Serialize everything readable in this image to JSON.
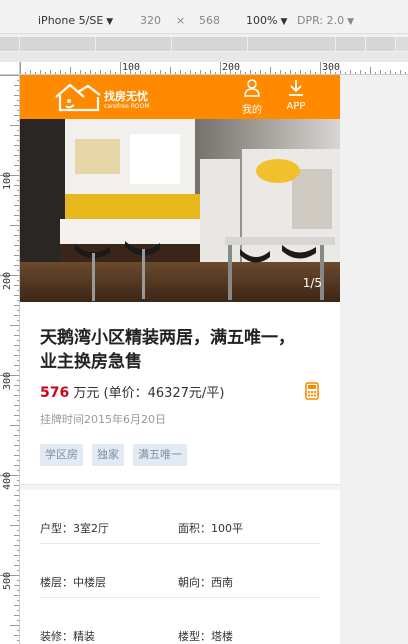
{
  "devtools": {
    "device": "iPhone 5/SE",
    "width": "320",
    "times": "×",
    "height": "568",
    "zoom": "100%",
    "dpr": "DPR: 2.0"
  },
  "ruler": {
    "h_labels": [
      "100",
      "200",
      "300"
    ],
    "v_labels": [
      "100",
      "200",
      "300",
      "400",
      "500"
    ]
  },
  "header": {
    "brand": "找房无忧",
    "brand_sub": "carefree ROOM",
    "me_label": "我的",
    "app_label": "APP",
    "bg_color": "#ff8a00"
  },
  "gallery": {
    "counter": "1/5"
  },
  "listing": {
    "title": "天鹅湾小区精装两居，满五唯一，业主换房急售",
    "price_amount": "576",
    "price_unit": "万元 (单价：46327元/平)",
    "listed_date": "挂牌时间2015年6月20日",
    "tags": [
      "学区房",
      "独家",
      "满五唯一"
    ],
    "price_color": "#d0021b"
  },
  "specs": [
    {
      "left": "户型：3室2厅",
      "right": "面积：100平"
    },
    {
      "left": "楼层：中楼层",
      "right": "朝向：西南"
    },
    {
      "left": "装修：精装",
      "right": "楼型：塔楼"
    }
  ]
}
